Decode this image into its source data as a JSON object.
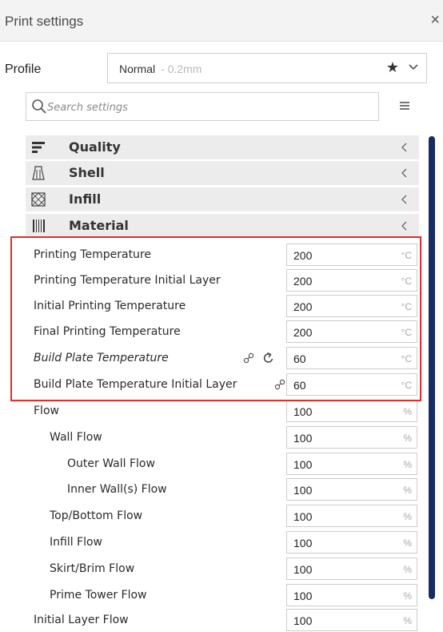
{
  "window": {
    "title": "Print settings",
    "close_glyph": "×"
  },
  "profile": {
    "label": "Profile",
    "name": "Normal",
    "detail": "- 0.2mm"
  },
  "search": {
    "placeholder": "Search settings"
  },
  "categories": [
    {
      "label": "Quality",
      "icon": "quality-icon"
    },
    {
      "label": "Shell",
      "icon": "shell-icon"
    },
    {
      "label": "Infill",
      "icon": "infill-icon"
    },
    {
      "label": "Material",
      "icon": "material-icon"
    }
  ],
  "settings": [
    {
      "label": "Printing Temperature",
      "value": "200",
      "unit": "°C"
    },
    {
      "label": "Printing Temperature Initial Layer",
      "value": "200",
      "unit": "°C"
    },
    {
      "label": "Initial Printing Temperature",
      "value": "200",
      "unit": "°C"
    },
    {
      "label": "Final Printing Temperature",
      "value": "200",
      "unit": "°C"
    },
    {
      "label": "Build Plate Temperature",
      "value": "60",
      "unit": "°C"
    },
    {
      "label": "Build Plate Temperature Initial Layer",
      "value": "60",
      "unit": "°C"
    },
    {
      "label": "Flow",
      "value": "100",
      "unit": "%"
    },
    {
      "label": "Wall Flow",
      "value": "100",
      "unit": "%"
    },
    {
      "label": "Outer Wall Flow",
      "value": "100",
      "unit": "%"
    },
    {
      "label": "Inner Wall(s) Flow",
      "value": "100",
      "unit": "%"
    },
    {
      "label": "Top/Bottom Flow",
      "value": "100",
      "unit": "%"
    },
    {
      "label": "Infill Flow",
      "value": "100",
      "unit": "%"
    },
    {
      "label": "Skirt/Brim Flow",
      "value": "100",
      "unit": "%"
    },
    {
      "label": "Prime Tower Flow",
      "value": "100",
      "unit": "%"
    },
    {
      "label": "Initial Layer Flow",
      "value": "100",
      "unit": "%"
    }
  ],
  "colors": {
    "highlight": "#e52b2b",
    "scrollbar": "#1a2a63",
    "category_bg": "#ececec"
  }
}
